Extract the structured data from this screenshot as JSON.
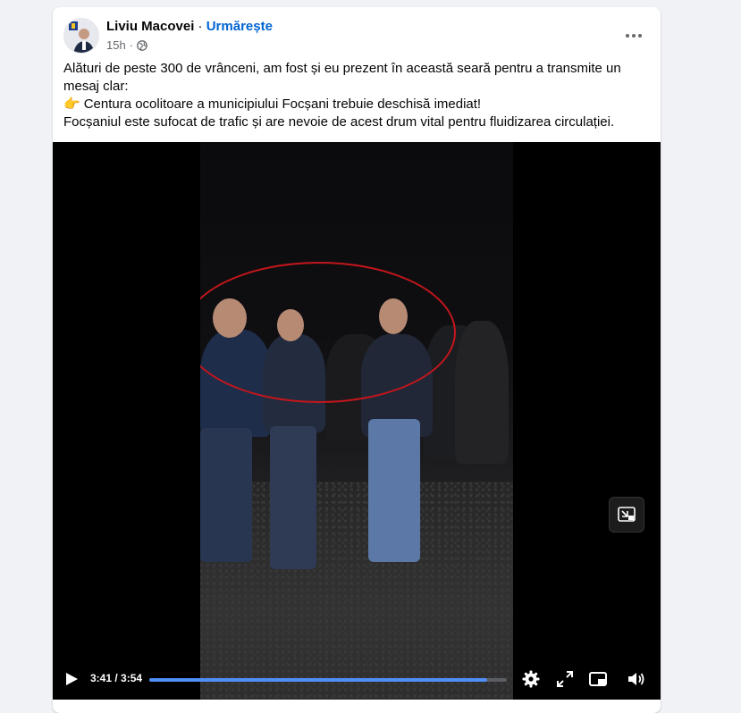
{
  "post": {
    "author": "Liviu Macovei",
    "separator": "·",
    "follow_label": "Urmărește",
    "time": "15h",
    "time_separator": "·",
    "privacy_icon": "globe-icon",
    "more_icon": "more-horizontal-icon",
    "text": {
      "line1": "Alături de peste 300 de vrânceni, am fost și eu prezent în această seară pentru a transmite un mesaj clar:",
      "pointing_emoji": "👉",
      "line2": "Centura ocolitoare a municipiului Focșani trebuie deschisă imediat!",
      "line3": "Focșaniul este sufocat de trafic și are nevoie de acest drum vital pentru fluidizarea circulației."
    }
  },
  "video": {
    "current_time": "3:41",
    "time_separator": " / ",
    "duration": "3:54",
    "progress": 0.944,
    "accent_color": "#4f8ff7",
    "highlight_color": "#c4161c",
    "icons": [
      "play-icon",
      "settings-icon",
      "fullscreen-icon",
      "picture-in-picture-icon",
      "volume-icon",
      "minimize-icon"
    ]
  }
}
